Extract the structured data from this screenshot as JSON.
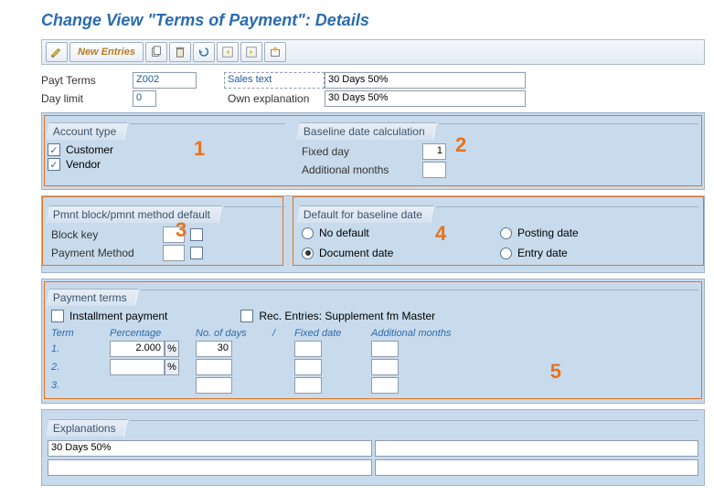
{
  "title": "Change View \"Terms of Payment\": Details",
  "toolbar": {
    "new_entries": "New Entries"
  },
  "header": {
    "payt_terms_label": "Payt Terms",
    "payt_terms_value": "Z002",
    "sales_text_label": "Sales text",
    "sales_text_value": "30 Days 50%",
    "day_limit_label": "Day limit",
    "day_limit_value": "0",
    "own_expl_label": "Own explanation",
    "own_expl_value": "30 Days 50%"
  },
  "account_type": {
    "title": "Account type",
    "customer_label": "Customer",
    "customer_checked": true,
    "vendor_label": "Vendor",
    "vendor_checked": true
  },
  "baseline_calc": {
    "title": "Baseline date calculation",
    "fixed_day_label": "Fixed day",
    "fixed_day_value": "1",
    "add_months_label": "Additional months",
    "add_months_value": ""
  },
  "pmnt_block": {
    "title": "Pmnt block/pmnt method default",
    "block_key_label": "Block key",
    "block_key_value": "",
    "pay_method_label": "Payment Method",
    "pay_method_value": ""
  },
  "default_baseline": {
    "title": "Default for baseline date",
    "no_default": "No default",
    "posting_date": "Posting date",
    "document_date": "Document date",
    "entry_date": "Entry date",
    "selected": "document_date"
  },
  "payment_terms": {
    "title": "Payment terms",
    "installment_label": "Installment payment",
    "rec_entries_label": "Rec. Entries: Supplement fm Master",
    "col_term": "Term",
    "col_pct": "Percentage",
    "col_days": "No. of days",
    "col_slash": "/",
    "col_fixed": "Fixed date",
    "col_addm": "Additional months",
    "rows": [
      {
        "n": "1.",
        "pct": "2.000",
        "days": "30",
        "fixed": "",
        "addm": ""
      },
      {
        "n": "2.",
        "pct": "",
        "days": "",
        "fixed": "",
        "addm": ""
      },
      {
        "n": "3.",
        "pct": null,
        "days": "",
        "fixed": "",
        "addm": ""
      }
    ]
  },
  "explanations": {
    "title": "Explanations",
    "v1": "30 Days 50%",
    "v2": "",
    "v3": "",
    "v4": ""
  },
  "annotations": {
    "a1": "1",
    "a2": "2",
    "a3": "3",
    "a4": "4",
    "a5": "5"
  }
}
